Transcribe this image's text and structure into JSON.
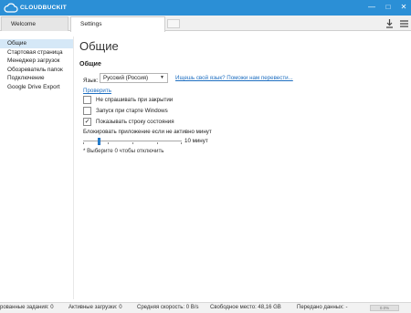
{
  "app": {
    "name": "CLOUDBUCKIT"
  },
  "window": {
    "minimize": "—",
    "maximize": "□",
    "close": "✕"
  },
  "tabs": [
    {
      "label": "Welcome",
      "active": false
    },
    {
      "label": "Settings",
      "active": true
    }
  ],
  "toolbar": {
    "download_icon": "download-icon",
    "menu_icon": "menu-icon"
  },
  "sidebar": {
    "items": [
      {
        "label": "Общие",
        "selected": true
      },
      {
        "label": "Стартовая страница",
        "selected": false
      },
      {
        "label": "Менеджер загрузок",
        "selected": false
      },
      {
        "label": "Обозреватель папок",
        "selected": false
      },
      {
        "label": "Подключение",
        "selected": false
      },
      {
        "label": "Google Drive Export",
        "selected": false
      }
    ]
  },
  "main": {
    "title": "Общие",
    "section_title": "Общие",
    "language_label": "Язык:",
    "language_value": "Русский (Россия)",
    "help_link": "Ищешь свой язык? Поможи нам перевести...",
    "check_link": "Проверить",
    "checkboxes": [
      {
        "label": "Не спрашивать при закрытии",
        "checked": false
      },
      {
        "label": "Запуск при старте Windows",
        "checked": false
      },
      {
        "label": "Показывать строку состояния",
        "checked": true
      }
    ],
    "lock_label": "Блокировать приложение если не активно минут",
    "lock_value": "10 минут",
    "lock_level": 0.15,
    "lock_hint": "* Выберите 0 чтобы отключить"
  },
  "status": {
    "tasks": "рованные задания: 0",
    "active": "Активные загрузки: 0",
    "speed": "Средняя скорость: 0 B/s",
    "free": "Свободное место: 48,16 GB",
    "transferred": "Передано данных: -",
    "progress": "0.0%"
  },
  "colors": {
    "accent": "#2b8fd6",
    "link": "#1f6fc1",
    "selected": "#d5e8f7"
  }
}
